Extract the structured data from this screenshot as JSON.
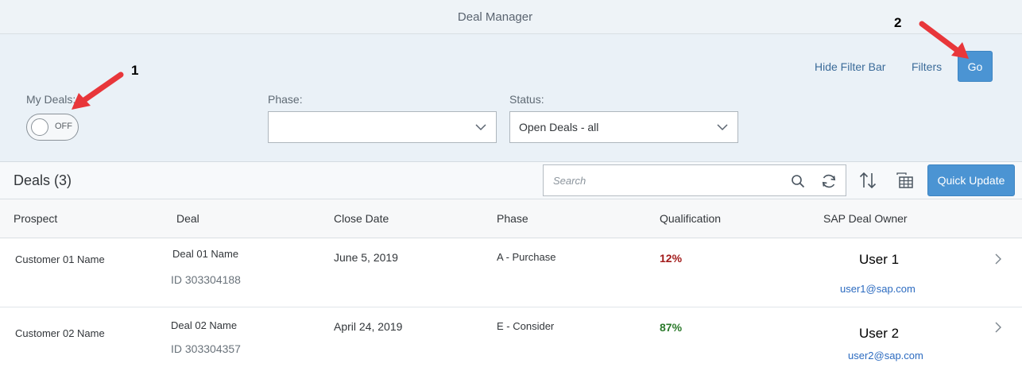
{
  "app": {
    "title": "Deal Manager"
  },
  "filter_bar": {
    "hide_label": "Hide Filter Bar",
    "filters_label": "Filters",
    "go_label": "Go",
    "my_deals": {
      "label": "My Deals:",
      "state": "OFF"
    },
    "phase": {
      "label": "Phase:",
      "value": ""
    },
    "status": {
      "label": "Status:",
      "value": "Open Deals - all"
    }
  },
  "toolbar": {
    "title": "Deals (3)",
    "search_placeholder": "Search",
    "quick_update_label": "Quick Update"
  },
  "table": {
    "columns": [
      "Prospect",
      "Deal",
      "Close Date",
      "Phase",
      "Qualification",
      "SAP Deal Owner"
    ],
    "rows": [
      {
        "prospect": "Customer 01 Name",
        "deal_name": "Deal 01 Name",
        "deal_id": "ID 303304188",
        "close_date": "June 5, 2019",
        "phase": "A - Purchase",
        "qualification": "12%",
        "qualification_color": "#a31c1c",
        "owner": "User 1",
        "owner_email": "user1@sap.com"
      },
      {
        "prospect": "Customer 02 Name",
        "deal_name": "Deal 02 Name",
        "deal_id": "ID 303304357",
        "close_date": "April 24, 2019",
        "phase": "E - Consider",
        "qualification": "87%",
        "qualification_color": "#2b7a2b",
        "owner": "User 2",
        "owner_email": "user2@sap.com"
      }
    ]
  },
  "annotations": {
    "marker_1": "1",
    "marker_2": "2"
  },
  "colors": {
    "accent": "#4b94d3",
    "arrow": "#e8363a"
  }
}
